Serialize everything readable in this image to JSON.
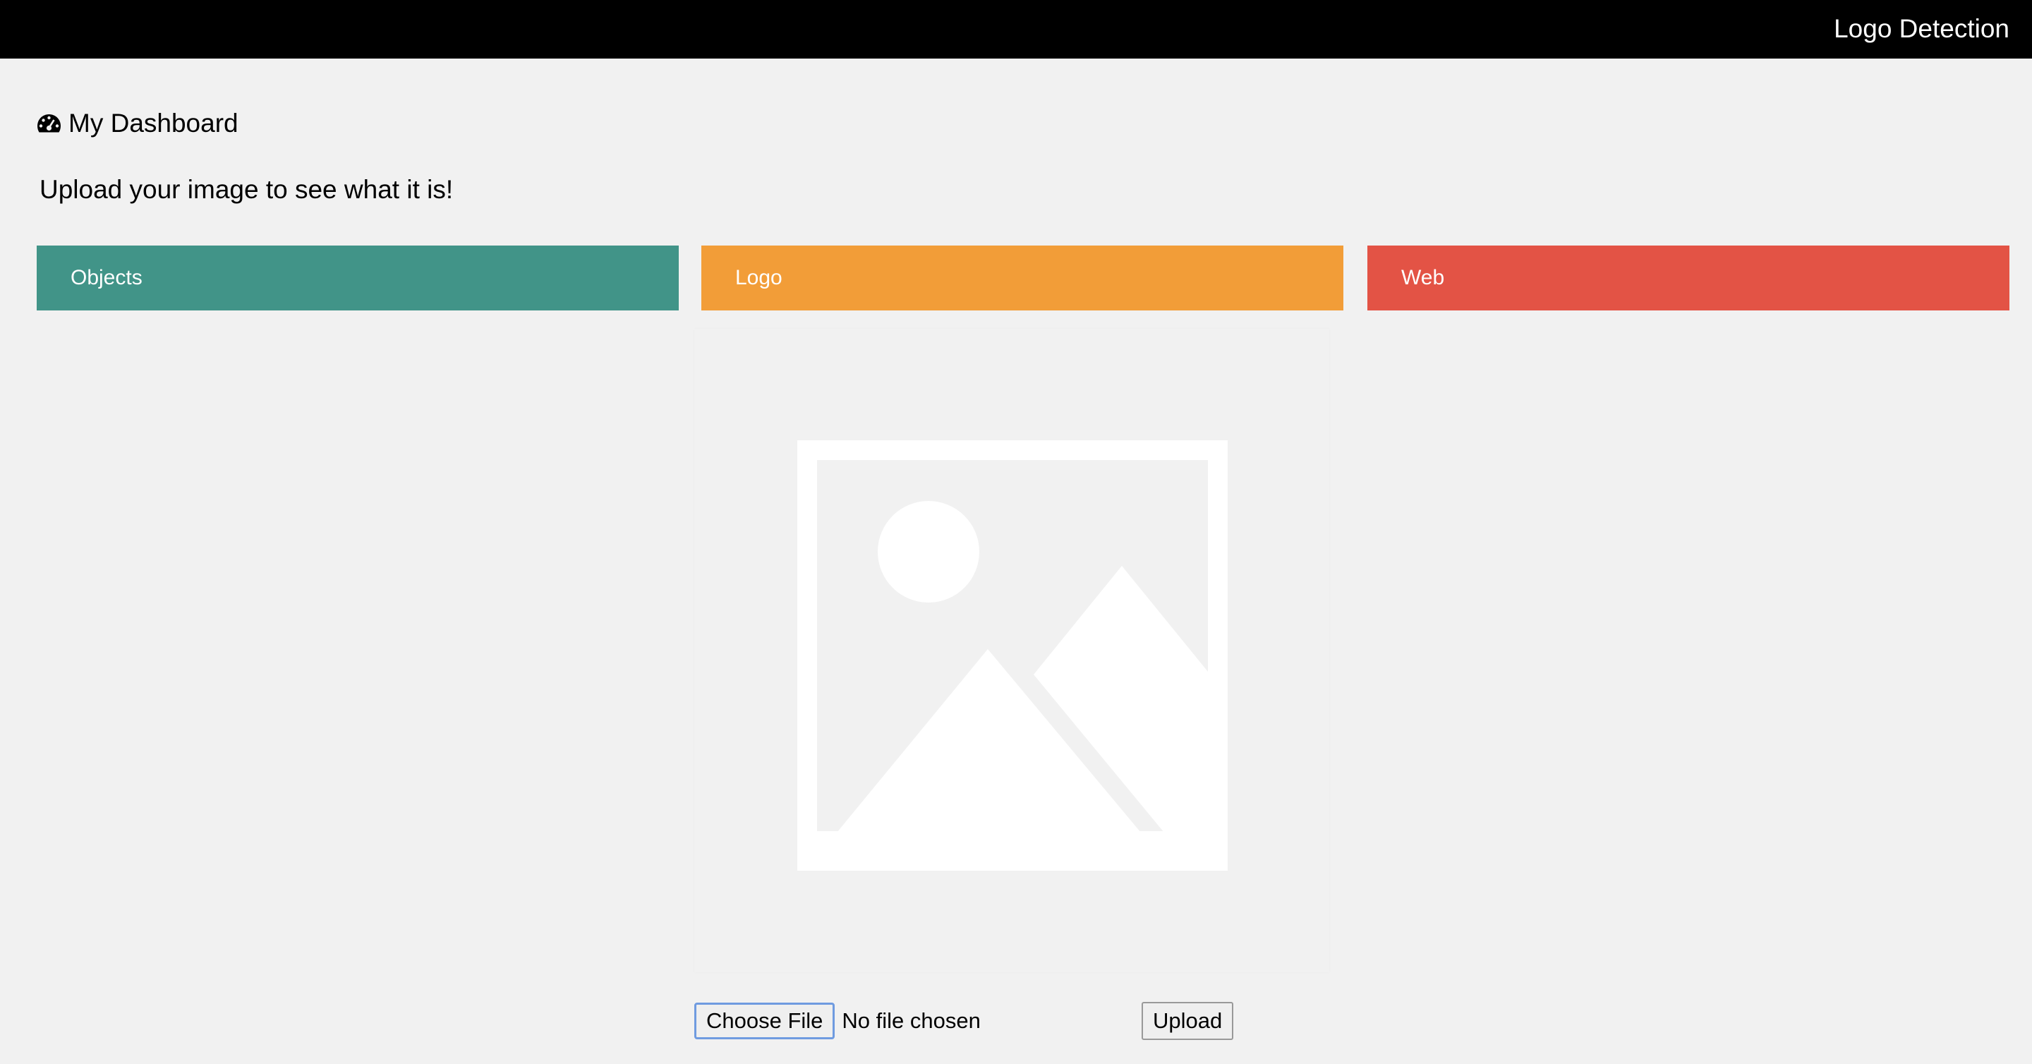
{
  "topbar": {
    "app_title": "Logo Detection"
  },
  "dashboard": {
    "icon": "dashboard-icon",
    "title": "My Dashboard",
    "subtitle": "Upload your image to see what it is!"
  },
  "panels": [
    {
      "label": "Objects",
      "color": "#419488"
    },
    {
      "label": "Logo",
      "color": "#f29d38"
    },
    {
      "label": "Web",
      "color": "#e35345"
    }
  ],
  "preview": {
    "icon": "image-placeholder-icon"
  },
  "file_input": {
    "button_label": "Choose File",
    "status": "No file chosen"
  },
  "upload": {
    "label": "Upload"
  }
}
